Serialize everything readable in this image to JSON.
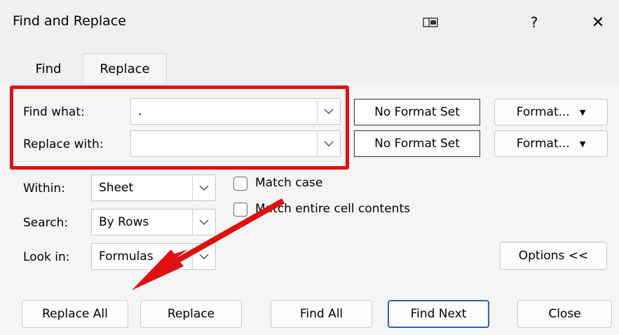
{
  "window": {
    "title": "Find and Replace",
    "help_label": "?",
    "close_label": "✕"
  },
  "tabs": [
    {
      "label": "Find",
      "active": false
    },
    {
      "label": "Replace",
      "active": true
    }
  ],
  "fields": {
    "find_label": "Find what:",
    "find_value": ".",
    "replace_label": "Replace with:",
    "replace_value": ""
  },
  "format": {
    "no_format_label": "No Format Set",
    "format_button_label": "Format...",
    "caret": "▼"
  },
  "options": {
    "within_label": "Within:",
    "within_value": "Sheet",
    "search_label": "Search:",
    "search_value": "By Rows",
    "lookin_label": "Look in:",
    "lookin_value": "Formulas",
    "match_case_label": "Match case",
    "match_entire_label": "Match entire cell contents",
    "options_button_label": "Options <<"
  },
  "buttons": {
    "replace_all": "Replace All",
    "replace": "Replace",
    "find_all": "Find All",
    "find_next": "Find Next",
    "close": "Close"
  },
  "colors": {
    "highlight": "#e01010",
    "primary_border": "#2f62b3"
  },
  "icons": {
    "dropdown": "chevron-down-icon",
    "preview": "preview-window-icon"
  }
}
